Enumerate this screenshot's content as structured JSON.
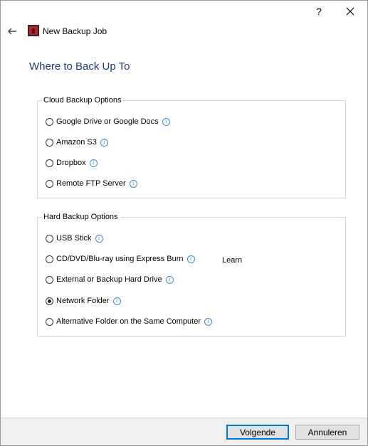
{
  "titlebar": {
    "help_label": "?",
    "close_icon": "close-icon"
  },
  "nav": {
    "title": "New Backup Job",
    "back_icon": "arrow-left-icon",
    "app_icon": "app-logo-icon",
    "app_icon_color": "#c0222a"
  },
  "heading": "Where to Back Up To",
  "cloud": {
    "legend": "Cloud Backup Options",
    "options": [
      {
        "label": "Google Drive or Google Docs",
        "checked": false
      },
      {
        "label": "Amazon S3",
        "checked": false
      },
      {
        "label": "Dropbox",
        "checked": false
      },
      {
        "label": "Remote FTP Server",
        "checked": false
      }
    ]
  },
  "hard": {
    "legend": "Hard Backup Options",
    "options": [
      {
        "label": "USB Stick",
        "checked": false
      },
      {
        "label": "CD/DVD/Blu-ray using Express Burn",
        "checked": false
      },
      {
        "label": "External or Backup Hard Drive",
        "checked": false
      },
      {
        "label": "Network Folder",
        "checked": true
      },
      {
        "label": "Alternative Folder on the Same Computer",
        "checked": false
      }
    ],
    "learn_label": "Learn"
  },
  "info_glyph": "i",
  "footer": {
    "next_label": "Volgende",
    "cancel_label": "Annuleren"
  },
  "colors": {
    "heading": "#1a3a84",
    "info": "#3b8edb",
    "primary_border": "#0078d7"
  }
}
